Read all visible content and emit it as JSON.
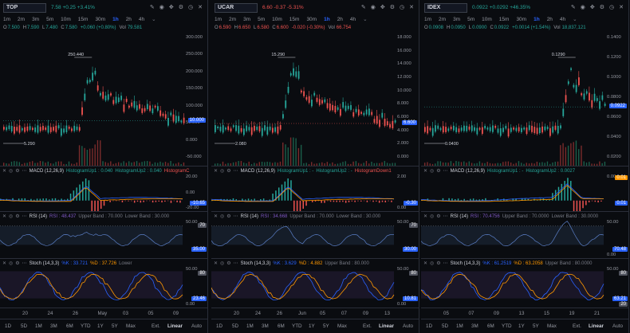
{
  "panels": [
    {
      "ticker": "TOP",
      "price": "7.58",
      "change": "+0.25",
      "pct": "+3.41%",
      "change_color": "#26a69a",
      "timeframes": [
        "1m",
        "2m",
        "3m",
        "5m",
        "10m",
        "15m",
        "30m",
        "1h",
        "2h",
        "4h"
      ],
      "active_tf": "1h",
      "ohlc": {
        "o_label": "O",
        "o": "7.500",
        "h_label": "H",
        "h": "7.590",
        "l_label": "L",
        "l": "7.480",
        "c_label": "C",
        "c": "7.580",
        "chg": "+0.060 (+0.80%)",
        "vol_label": "Vol",
        "vol": "79.581"
      },
      "price_axis": [
        "300.000",
        "250.000",
        "200.000",
        "150.000",
        "100.000",
        "50.000",
        "0.000",
        "-50.000"
      ],
      "last_price_tag": "10.000",
      "hi_label": "250.440",
      "lo_label": "5.290",
      "macd": {
        "title": "MACD (12,26,9)",
        "h1": "HistogramUp1 : 0.040",
        "h2": "HistogramUp2 : 0.040",
        "h3": "HistogramC",
        "tag": "-10.65",
        "axis": [
          "20.00",
          "0.00",
          "-20.00"
        ]
      },
      "rsi": {
        "title": "RSI (14)",
        "val": "RSI : 48.437",
        "ub": "Upper Band : 70.000",
        "lb": "Lower Band : 30.000",
        "tag": "35.00",
        "tag2": "70",
        "axis": [
          "50.00"
        ]
      },
      "stoch": {
        "title": "Stoch (14,3,3)",
        "k": "%K : 33.721",
        "d": "%D : 37.726",
        "lb": "Lower",
        "tag": "23.46",
        "tag2": "80",
        "axis": [
          "50.00",
          "0.00"
        ]
      },
      "xaxis": [
        "20",
        "24",
        "26",
        "May",
        "03",
        "05",
        "09"
      ],
      "bottom": [
        "1D",
        "5D",
        "1M",
        "3M",
        "6M",
        "YTD",
        "1Y",
        "5Y",
        "Max",
        "Ext.",
        "Linear",
        "Auto"
      ]
    },
    {
      "ticker": "UCAR",
      "price": "6.60",
      "change": "-0.37",
      "pct": "-5.31%",
      "change_color": "#ef5350",
      "timeframes": [
        "1m",
        "2m",
        "3m",
        "5m",
        "10m",
        "15m",
        "30m",
        "1h",
        "2h",
        "4h"
      ],
      "active_tf": "1h",
      "ohlc": {
        "o_label": "O",
        "o": "6.590",
        "h_label": "H",
        "h": "6.650",
        "l_label": "L",
        "l": "6.580",
        "c_label": "C",
        "c": "6.600",
        "chg": "-0.020 (-0.30%)",
        "vol_label": "Vol",
        "vol": "66.754"
      },
      "price_axis": [
        "18.000",
        "16.000",
        "14.000",
        "12.000",
        "10.000",
        "8.000",
        "6.000",
        "4.000",
        "2.000",
        "0.000"
      ],
      "last_price_tag": "6.600",
      "hi_label": "15.290",
      "lo_label": "2.080",
      "macd": {
        "title": "MACD (12,26,9)",
        "h1": "HistogramUp1 : -",
        "h2": "HistogramUp2 : -",
        "h3": "HistogramDown1",
        "tag": "-0.30",
        "axis": [
          "2.00",
          "0.00"
        ]
      },
      "rsi": {
        "title": "RSI (14)",
        "val": "RSI : 34.668",
        "ub": "Upper Band : 70.000",
        "lb": "Lower Band : 30.000",
        "tag": "30.00",
        "tag2": "70",
        "axis": [
          "50.00"
        ]
      },
      "stoch": {
        "title": "Stoch (14,3,3)",
        "k": "%K : 3.629",
        "d": "%D : 4.882",
        "lb": "Upper Band : 80.000",
        "tag": "10.81",
        "tag2": "80",
        "axis": [
          "50.00",
          "0.00"
        ]
      },
      "xaxis": [
        "20",
        "24",
        "26",
        "Jun",
        "05",
        "07",
        "09",
        "13"
      ],
      "bottom": [
        "1D",
        "5D",
        "1M",
        "3M",
        "6M",
        "YTD",
        "1Y",
        "5Y",
        "Max",
        "Ext.",
        "Linear",
        "Auto"
      ]
    },
    {
      "ticker": "IDEX",
      "price": "0.0922",
      "change": "+0.0292",
      "pct": "+46.35%",
      "change_color": "#26a69a",
      "timeframes": [
        "1m",
        "2m",
        "3m",
        "5m",
        "10m",
        "15m",
        "30m",
        "1h",
        "2h",
        "4h"
      ],
      "active_tf": "1h",
      "ohlc": {
        "o_label": "O",
        "o": "0.0908",
        "h_label": "H",
        "h": "0.0950",
        "l_label": "L",
        "l": "0.0900",
        "c_label": "C",
        "c": "0.0922",
        "chg": "+0.0014 (+1.54%)",
        "vol_label": "Vol",
        "vol": "18,837,121"
      },
      "price_axis": [
        "0.1400",
        "0.1200",
        "0.1000",
        "0.0800",
        "0.0600",
        "0.0400",
        "0.0200"
      ],
      "last_price_tag": "0.0922",
      "hi_label": "0.1290",
      "lo_label": "0.0400",
      "macd": {
        "title": "MACD (12,26,9)",
        "h1": "HistogramUp1 : -",
        "h2": "HistogramUp2 : 0.0027",
        "h3": "",
        "tag": "0.01",
        "tag2": "0.01",
        "axis": [
          "0.00"
        ]
      },
      "rsi": {
        "title": "RSI (14)",
        "val": "RSI : 70.4756",
        "ub": "Upper Band : 70.0000",
        "lb": "Lower Band : 30.0000",
        "tag": "70.48",
        "axis": [
          "50.00",
          "0.00"
        ]
      },
      "stoch": {
        "title": "Stoch (14,3,3)",
        "k": "%K : 61.2519",
        "d": "%D : 63.2058",
        "lb": "Upper Band : 80.0000",
        "tag": "63.21",
        "tag2": "80",
        "tag3": "20",
        "axis": [
          "50.00"
        ]
      },
      "xaxis": [
        "05",
        "07",
        "09",
        "13",
        "15",
        "19",
        "21"
      ],
      "bottom": [
        "1D",
        "5D",
        "1M",
        "3M",
        "6M",
        "YTD",
        "1Y",
        "5Y",
        "Max",
        "Ext.",
        "Linear",
        "Auto"
      ]
    }
  ]
}
